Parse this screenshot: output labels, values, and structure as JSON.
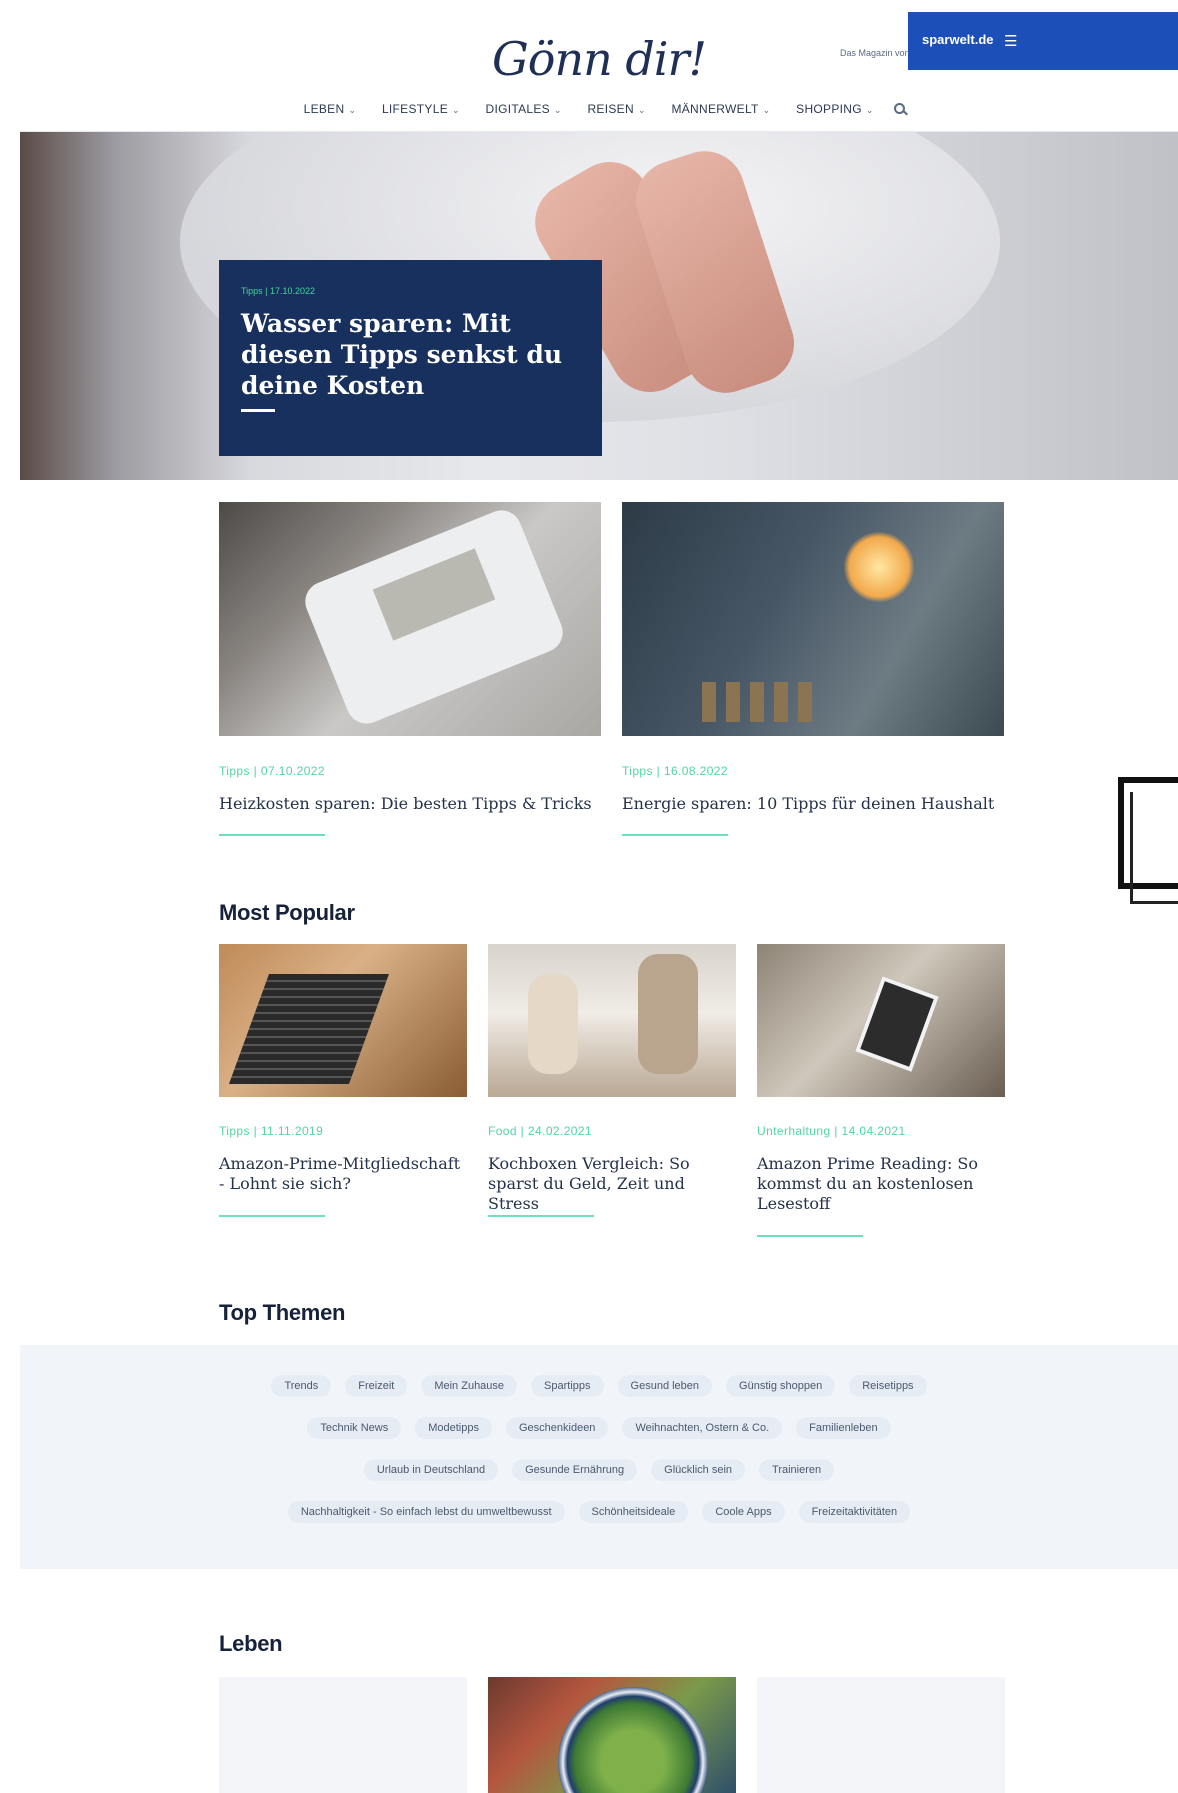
{
  "header": {
    "logo_text": "Gönn dir!",
    "magazin_note": "Das Magazin von",
    "brand_logo": "sparwelt.de",
    "menu_icon": "hamburger-menu-icon",
    "brand_color": "#1d4fb8"
  },
  "nav": {
    "items": [
      {
        "label": "LEBEN"
      },
      {
        "label": "LIFESTYLE"
      },
      {
        "label": "DIGITALES"
      },
      {
        "label": "REISEN"
      },
      {
        "label": "MÄNNERWELT"
      },
      {
        "label": "SHOPPING"
      }
    ],
    "search_icon": "search-icon"
  },
  "hero": {
    "meta": "Tipps | 17.10.2022",
    "title": "Wasser sparen: Mit diesen Tipps senkst du deine Kosten",
    "card_color": "#17305e"
  },
  "featured": [
    {
      "meta": "Tipps | 07.10.2022",
      "title": "Heizkosten sparen: Die besten Tipps & Tricks"
    },
    {
      "meta": "Tipps | 16.08.2022",
      "title": "Energie sparen: 10 Tipps für deinen Haushalt"
    }
  ],
  "most_popular": {
    "title": "Most Popular",
    "items": [
      {
        "meta": "Tipps | 11.11.2019",
        "title": "Amazon-Prime-Mitgliedschaft - Lohnt sie sich?"
      },
      {
        "meta": "Food | 24.02.2021",
        "title": "Kochboxen Vergleich: So sparst du Geld, Zeit und Stress"
      },
      {
        "meta": "Unterhaltung | 14.04.2021",
        "title": "Amazon Prime Reading: So kommst du an kostenlosen Lesestoff"
      }
    ]
  },
  "top_themen": {
    "title": "Top Themen",
    "rows": [
      [
        "Trends",
        "Freizeit",
        "Mein Zuhause",
        "Spartipps",
        "Gesund leben",
        "Günstig shoppen",
        "Reisetipps"
      ],
      [
        "Technik News",
        "Modetipps",
        "Geschenkideen",
        "Weihnachten, Ostern & Co.",
        "Familienleben"
      ],
      [
        "Urlaub in Deutschland",
        "Gesunde Ernährung",
        "Glücklich sein",
        "Trainieren"
      ],
      [
        "Nachhaltigkeit - So einfach lebst du umweltbewusst",
        "Schönheitsideale",
        "Coole Apps",
        "Freizeitaktivitäten"
      ]
    ]
  },
  "leben": {
    "title": "Leben"
  },
  "accent_color": "#4fd6a2"
}
